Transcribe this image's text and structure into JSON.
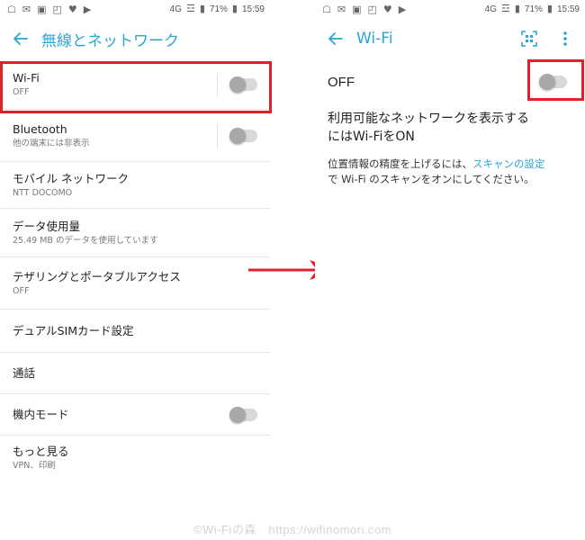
{
  "status_bar": {
    "network": "4G",
    "battery": "71%",
    "time": "15:59"
  },
  "left": {
    "title": "無線とネットワーク",
    "items": [
      {
        "title": "Wi-Fi",
        "subtitle": "OFF"
      },
      {
        "title": "Bluetooth",
        "subtitle": "他の端末には非表示"
      },
      {
        "title": "モバイル ネットワーク",
        "subtitle": "NTT DOCOMO"
      },
      {
        "title": "データ使用量",
        "subtitle": "25.49 MB のデータを使用しています"
      },
      {
        "title": "テザリングとポータブルアクセス",
        "subtitle": "OFF"
      },
      {
        "title": "デュアルSIMカード設定"
      },
      {
        "title": "通話"
      },
      {
        "title": "機内モード"
      },
      {
        "title": "もっと見る",
        "subtitle": "VPN、印刷"
      }
    ]
  },
  "right": {
    "title": "Wi-Fi",
    "toggle_label": "OFF",
    "message_line1": "利用可能なネットワークを表示する",
    "message_line2": "にはWi-FiをON",
    "location_text_before": "位置情報の精度を上げるには、",
    "location_link": "スキャンの設定",
    "location_text_after": "で Wi-Fi のスキャンをオンにしてください。"
  },
  "watermark": "©Wi-Fiの森　https://wifinomori.com",
  "colors": {
    "accent": "#2aa6d6",
    "highlight": "#e0202a",
    "toggle_off_track": "#d9d9d9",
    "toggle_off_knob": "#a8a8a8"
  }
}
